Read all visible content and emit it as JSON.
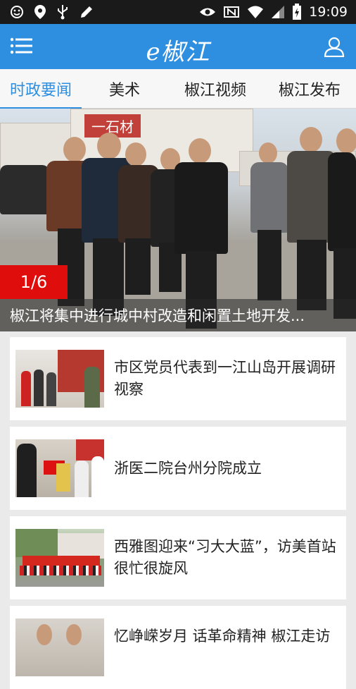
{
  "status_bar": {
    "time": "19:09",
    "left_icons": [
      "smiley-icon",
      "location-icon",
      "usb-icon",
      "pencil-icon"
    ],
    "right_icons": [
      "eye-icon",
      "nfc-icon",
      "wifi-icon",
      "signal-icon",
      "battery-icon"
    ]
  },
  "app_bar": {
    "brand": "e椒江",
    "background": "#2e8ee0"
  },
  "tabs": [
    {
      "label": "时政要闻",
      "active": true
    },
    {
      "label": "美术",
      "active": false
    },
    {
      "label": "椒江视频",
      "active": false
    },
    {
      "label": "椒江发布",
      "active": false
    }
  ],
  "hero": {
    "sign_text": "一石材",
    "counter": "1/6",
    "caption": "椒江将集中进行城中村改造和闲置土地开发..."
  },
  "news": [
    {
      "title": "市区党员代表到一江山岛开展调研视察"
    },
    {
      "title": "浙医二院台州分院成立"
    },
    {
      "title": "西雅图迎来“习大大蓝”，访美首站很忙很旋风"
    },
    {
      "title": "忆峥嵘岁月 话革命精神 椒江走访"
    }
  ]
}
